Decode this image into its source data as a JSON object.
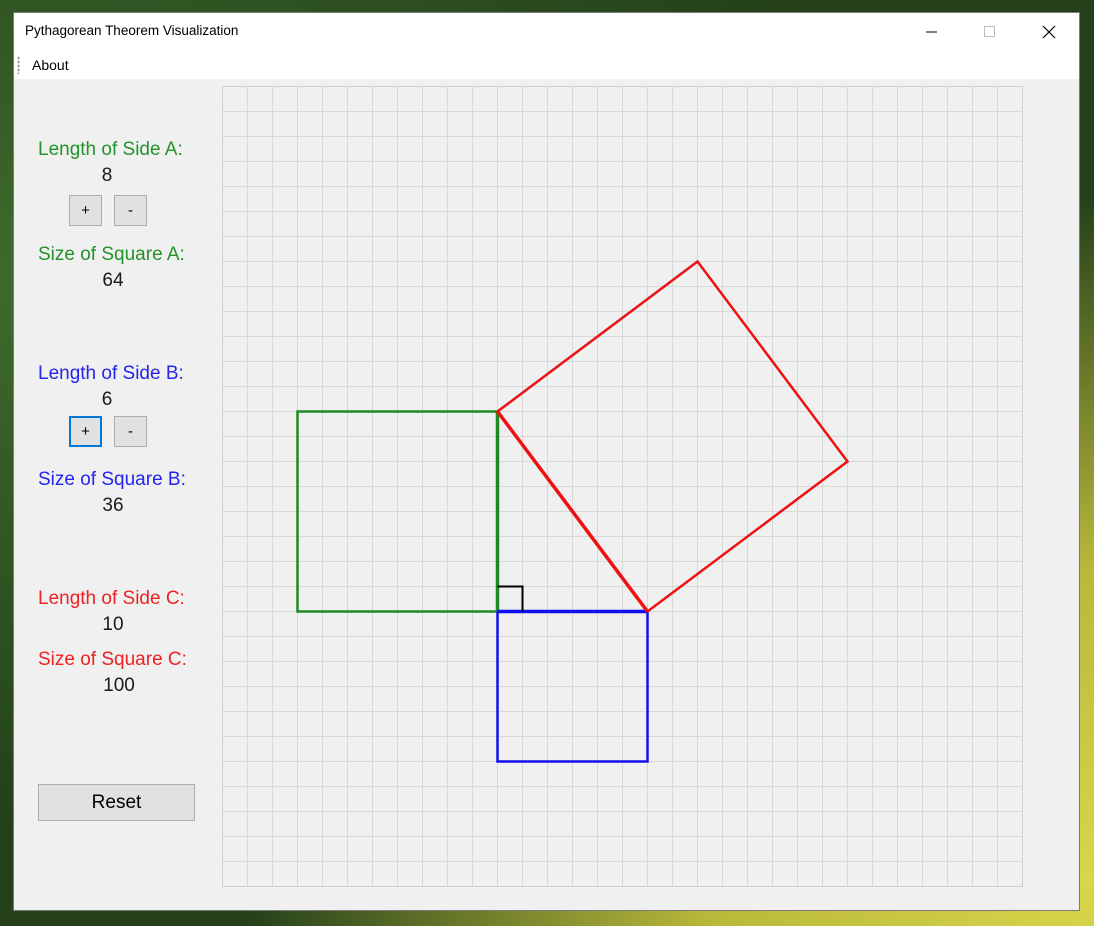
{
  "window": {
    "title": "Pythagorean Theorem Visualization"
  },
  "menu": {
    "items": [
      "About"
    ]
  },
  "side_a": {
    "length_label": "Length of Side A:",
    "length_value": "8",
    "square_label": "Size of Square A:",
    "square_value": "64",
    "plus_label": "+",
    "minus_label": "-",
    "color": "#1f8a24"
  },
  "side_b": {
    "length_label": "Length of Side B:",
    "length_value": "6",
    "square_label": "Size of Square B:",
    "square_value": "36",
    "plus_label": "+",
    "minus_label": "-",
    "color": "#1010ee"
  },
  "side_c": {
    "length_label": "Length of Side C:",
    "length_value": "10",
    "square_label": "Size of Square C:",
    "square_value": "100",
    "color": "#ee1111"
  },
  "reset_label": "Reset",
  "grid": {
    "cells": 32,
    "color": "#d8d8d8",
    "border": "#cfcfcf"
  },
  "triangle": {
    "a": 8,
    "b": 6,
    "c": 10
  }
}
